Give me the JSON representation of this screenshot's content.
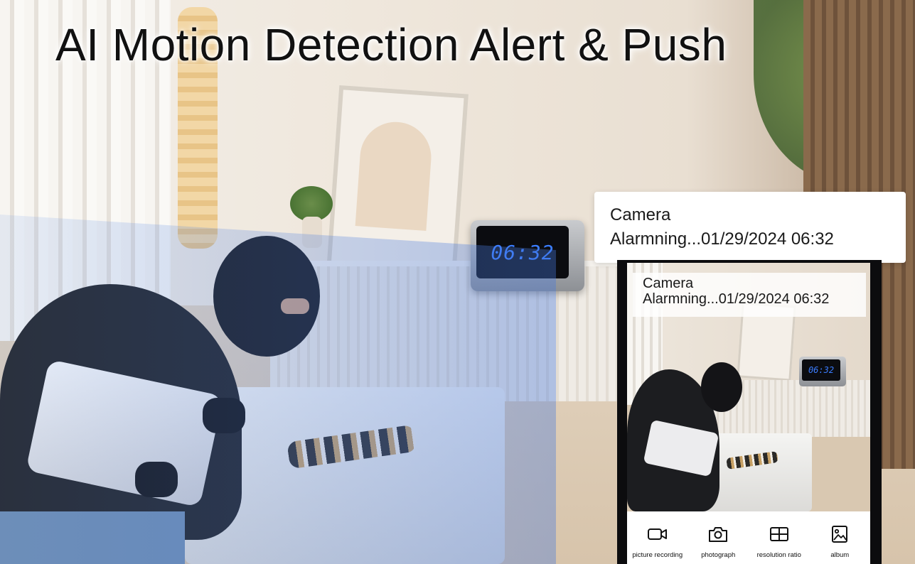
{
  "headline": "AI Motion Detection Alert & Push",
  "clock": {
    "time": "06:32"
  },
  "notification": {
    "title": "Camera",
    "message": "Alarmning...01/29/2024 06:32"
  },
  "phone": {
    "overlay": {
      "title": "Camera",
      "message": "Alarmning...01/29/2024 06:32"
    },
    "mini_clock_time": "06:32",
    "toolbar": [
      {
        "label": "picture recording",
        "icon": "video-camera-icon"
      },
      {
        "label": "photograph",
        "icon": "camera-icon"
      },
      {
        "label": "resolution ratio",
        "icon": "grid-icon"
      },
      {
        "label": "album",
        "icon": "image-icon"
      }
    ]
  },
  "colors": {
    "clock_digits": "#3b7dff",
    "beam": "#4678dc"
  }
}
